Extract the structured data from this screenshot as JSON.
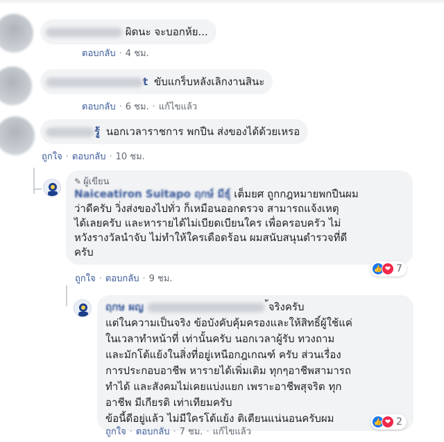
{
  "comments": [
    {
      "text": "ผิดนะ จะบอกห้ย...",
      "reply_label": "ตอบกลับ",
      "time": "4 ชม."
    },
    {
      "name_visible_suffix": "t",
      "text": "ขับแกร็บหลังเลิกงานสินะ",
      "reply_label": "ตอบกลับ",
      "time": "6 ชม.",
      "edited_label": "แก้ไขแล้ว"
    },
    {
      "name_visible_suffix": "รู้",
      "text": "นอกเวลาราชการ พกปืน ส่งของได้ด้วยเหรอ",
      "like_label": "ถูกใจ",
      "reply_label": "ตอบกลับ",
      "time": "10 ชม."
    }
  ],
  "author_reply": {
    "badge": "ผู้เขียน",
    "name": "Naiceatiron Suitapo ฤกษ์ มีธุ์",
    "lines": [
      "เต็มยศ ถูกกฎหมายพกปืนผม",
      "ว่าดีครับ วิ่งส่งของไปทั่ว ก็เหมือนออกตรวจ สามารถแจ้งเหตุ",
      "ได้เลยครับ และหารายได้ไม่เบียดเบียนใคร เพื่อครอบครัว ไม่",
      "หวังรางวัลนำจับ ไม่ทำให้ใครเดือดร้อน ผมสนับสนุนตำรวจที่ดี",
      "ครับ"
    ],
    "like_label": "ถูกใจ",
    "reply_label": "ตอบกลับ",
    "time": "9 ชม.",
    "reaction_count": "7"
  },
  "nested_reply": {
    "name_partial": "ฤกษ ผญ",
    "lines": [
      "้จริงครับ",
      "แต่ในความเป็นจริง ข้อบังคับคุ้มครองและให้สิทธิ์ผู้ใช้แค่",
      "ในเวลาทำหน้าที่ เท่านั้นครับ นอกเวลาผู้รับ ทวงถาม",
      "และมักโต้แย้งในสิ่งที่อยู่เหนือกฎเกณฑ์ ครับ ส่วนเรื่อง",
      "การประกอบอาชีพ หารายได้เพิ่มเติม ทุกๆอาชีพสามารถ",
      "ทำได้ และสังคมไม่เคยแบ่งแยก เพราะอาชีพสุจริต ทุก",
      "อาชีพ มีเกียรติ เท่าเทียมครับ",
      "ข้อนี้ดีอยู่แล้ว ไม่มีใครโต้แย้ง ติเตียนแน่นอนครับผม"
    ],
    "like_label": "ถูกใจ",
    "reply_label": "ตอบกลับ",
    "time": "7 ชม.",
    "edited_label": "แก้ไขแล้ว",
    "reaction_count": "2"
  },
  "icons": [
    "like-reaction-icon",
    "love-reaction-icon",
    "pencil-icon",
    "page-avatar"
  ],
  "colors": {
    "link": "#385898",
    "bubble": "#f2f3f5",
    "like": "#1877f2",
    "love": "#f0284a"
  }
}
